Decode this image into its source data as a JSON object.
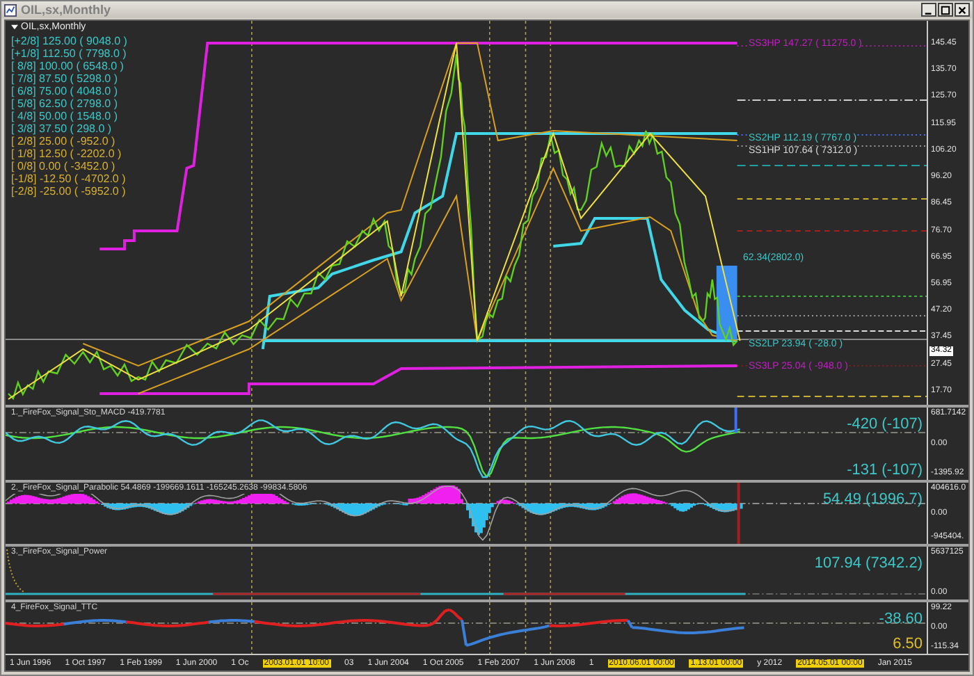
{
  "window": {
    "title": "OIL,sx,Monthly"
  },
  "main_pane": {
    "symbol": "OIL,sx,Monthly",
    "levels": [
      {
        "tag": "[+2/8]",
        "value": "125.00 ( 9048.0 )",
        "color": "#3cc8c8"
      },
      {
        "tag": "[+1/8]",
        "value": "112.50 ( 7798.0 )",
        "color": "#3cc8c8"
      },
      {
        "tag": "[ 8/8]",
        "value": "100.00 ( 6548.0 )",
        "color": "#3cc8c8"
      },
      {
        "tag": "[ 7/8]",
        "value": "87.50 ( 5298.0 )",
        "color": "#3cc8c8"
      },
      {
        "tag": "[ 6/8]",
        "value": "75.00 ( 4048.0 )",
        "color": "#3cc8c8"
      },
      {
        "tag": "[ 5/8]",
        "value": "62.50 ( 2798.0 )",
        "color": "#3cc8c8"
      },
      {
        "tag": "[ 4/8]",
        "value": "50.00 ( 1548.0 )",
        "color": "#3cc8c8"
      },
      {
        "tag": "[ 3/8]",
        "value": "37.50 ( 298.0 )",
        "color": "#3cc8c8"
      },
      {
        "tag": "[ 2/8]",
        "value": "25.00 ( -952.0 )",
        "color": "#d8b030"
      },
      {
        "tag": "[ 1/8]",
        "value": "12.50 ( -2202.0 )",
        "color": "#d8b030"
      },
      {
        "tag": "[ 0/8]",
        "value": "0.00 ( -3452.0 )",
        "color": "#d8b030"
      },
      {
        "tag": "[-1/8]",
        "value": "-12.50 ( -4702.0 )",
        "color": "#d8b030"
      },
      {
        "tag": "[-2/8]",
        "value": "-25.00 ( -5952.0 )",
        "color": "#d8b030"
      }
    ],
    "line_labels": [
      {
        "text": "SS3HP 147.27 ( 11275.0 )",
        "color": "#c020c0"
      },
      {
        "text": "SS2HP 112.19 ( 7767.0 )",
        "color": "#3cc8c8"
      },
      {
        "text": "SS1HP 107.64 ( 7312.0 )",
        "color": "#d8d8d8"
      },
      {
        "text": "62.34(2802.0)",
        "color": "#3cc8c8"
      },
      {
        "text": "SS2LP 23.94 ( -28.0 )",
        "color": "#3cc8c8"
      },
      {
        "text": "SS3LP 25.04 ( -948.0 )",
        "color": "#c020c0"
      }
    ],
    "price_scale": [
      "145.45",
      "135.70",
      "125.70",
      "115.95",
      "106.20",
      "96.20",
      "86.45",
      "76.70",
      "66.95",
      "56.95",
      "47.20",
      "37.45",
      "27.45",
      "17.70"
    ],
    "current_price": "34.32"
  },
  "indicators": [
    {
      "title": "1._FireFox_Signal_Sto_MACD -419.7781",
      "readings": [
        {
          "text": "-420 (-107)",
          "color": "#3cc8c8"
        },
        {
          "text": "-131 (-107)",
          "color": "#3cc8c8"
        }
      ],
      "scale": [
        "681.7142",
        "0.00",
        "-1395.92"
      ]
    },
    {
      "title": "2._FireFox_Signal_Parabolic 54.4869 -199669.1611 -165245.2638 -99834.5806",
      "readings": [
        {
          "text": "54.49 (1996.7)",
          "color": "#3cc8c8"
        }
      ],
      "scale": [
        "404616.0",
        "0.00",
        "-945404."
      ]
    },
    {
      "title": "3._FireFox_Signal_Power",
      "readings": [
        {
          "text": "107.94 (7342.2)",
          "color": "#3cc8c8"
        }
      ],
      "scale": [
        "5637125",
        "0.00"
      ]
    },
    {
      "title": "4_FireFox_Signal_TTC",
      "readings": [
        {
          "text": "-38.60",
          "color": "#3cc8c8"
        },
        {
          "text": "6.50",
          "color": "#e0c020"
        }
      ],
      "scale": [
        "99.22",
        "0.00",
        "-115.34"
      ]
    }
  ],
  "time_axis": [
    {
      "kind": "date",
      "text": "1 Jun 1996"
    },
    {
      "kind": "date",
      "text": "1 Oct 1997"
    },
    {
      "kind": "date",
      "text": "1 Feb 1999"
    },
    {
      "kind": "date",
      "text": "1 Jun 2000"
    },
    {
      "kind": "date",
      "text": "1 Oc"
    },
    {
      "kind": "marker",
      "text": "2003.01.01 10:00"
    },
    {
      "kind": "date",
      "text": "03"
    },
    {
      "kind": "date",
      "text": "1 Jun 2004"
    },
    {
      "kind": "date",
      "text": "1 Oct 2005"
    },
    {
      "kind": "date",
      "text": "1 Feb 2007"
    },
    {
      "kind": "date",
      "text": "1 Jun 2008"
    },
    {
      "kind": "date",
      "text": "1"
    },
    {
      "kind": "marker",
      "text": "2010.06.01 00:00"
    },
    {
      "kind": "marker",
      "text": "1.13.01 00:00"
    },
    {
      "kind": "date",
      "text": "y 2012"
    },
    {
      "kind": "marker",
      "text": "2014.05.01 00:00"
    },
    {
      "kind": "date",
      "text": "Jan 2015"
    }
  ]
}
